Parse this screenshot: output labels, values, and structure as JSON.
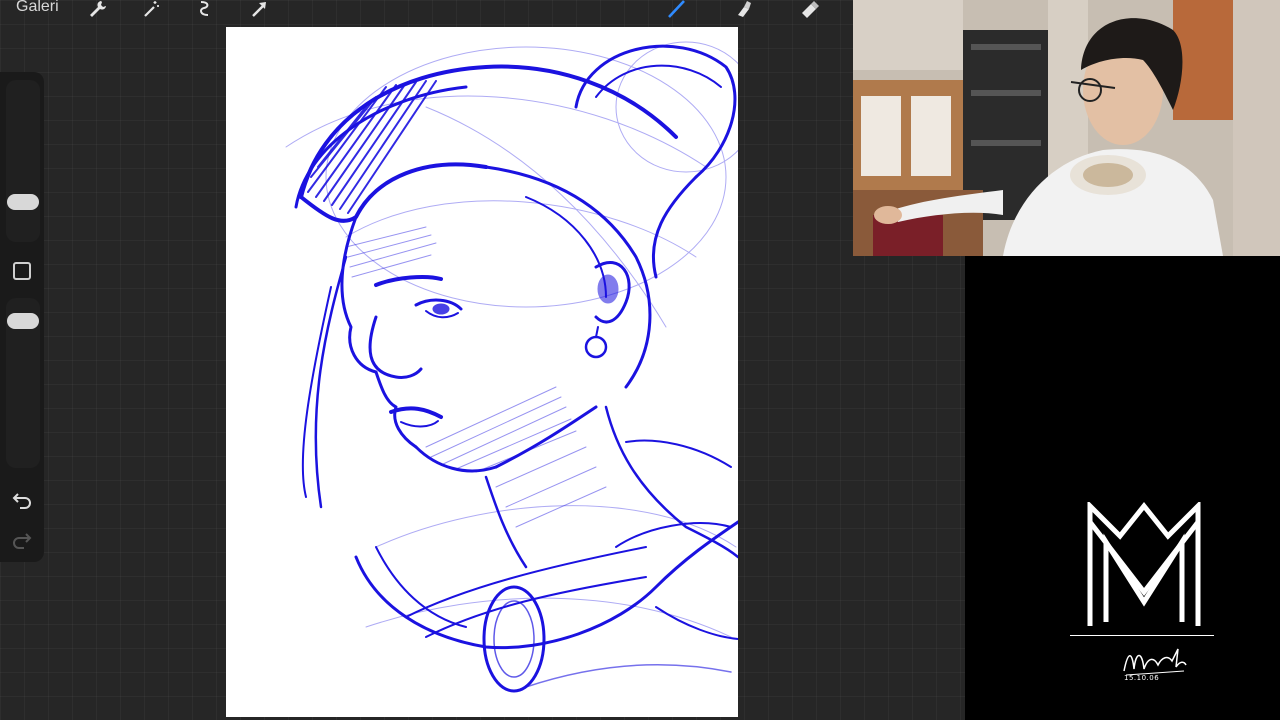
{
  "app": {
    "gallery_label": "Galeri",
    "tools_left": [
      {
        "icon": "wrench-icon"
      },
      {
        "icon": "magic-wand-icon"
      },
      {
        "icon": "selection-icon"
      },
      {
        "icon": "transform-arrow-icon"
      }
    ],
    "tools_right": [
      {
        "icon": "brush-icon"
      },
      {
        "icon": "smudge-icon"
      },
      {
        "icon": "eraser-icon"
      }
    ],
    "sidebar": {
      "brush_size": 0.22,
      "brush_opacity": 0.9,
      "modify_icon": "square-icon",
      "undo_icon": "undo-icon",
      "redo_icon": "redo-icon"
    }
  },
  "colors": {
    "ink": "#1b12e0",
    "canvas": "#ffffff",
    "ui_bg": "#262626"
  },
  "overlay": {
    "signature_date": "15.10.06"
  }
}
